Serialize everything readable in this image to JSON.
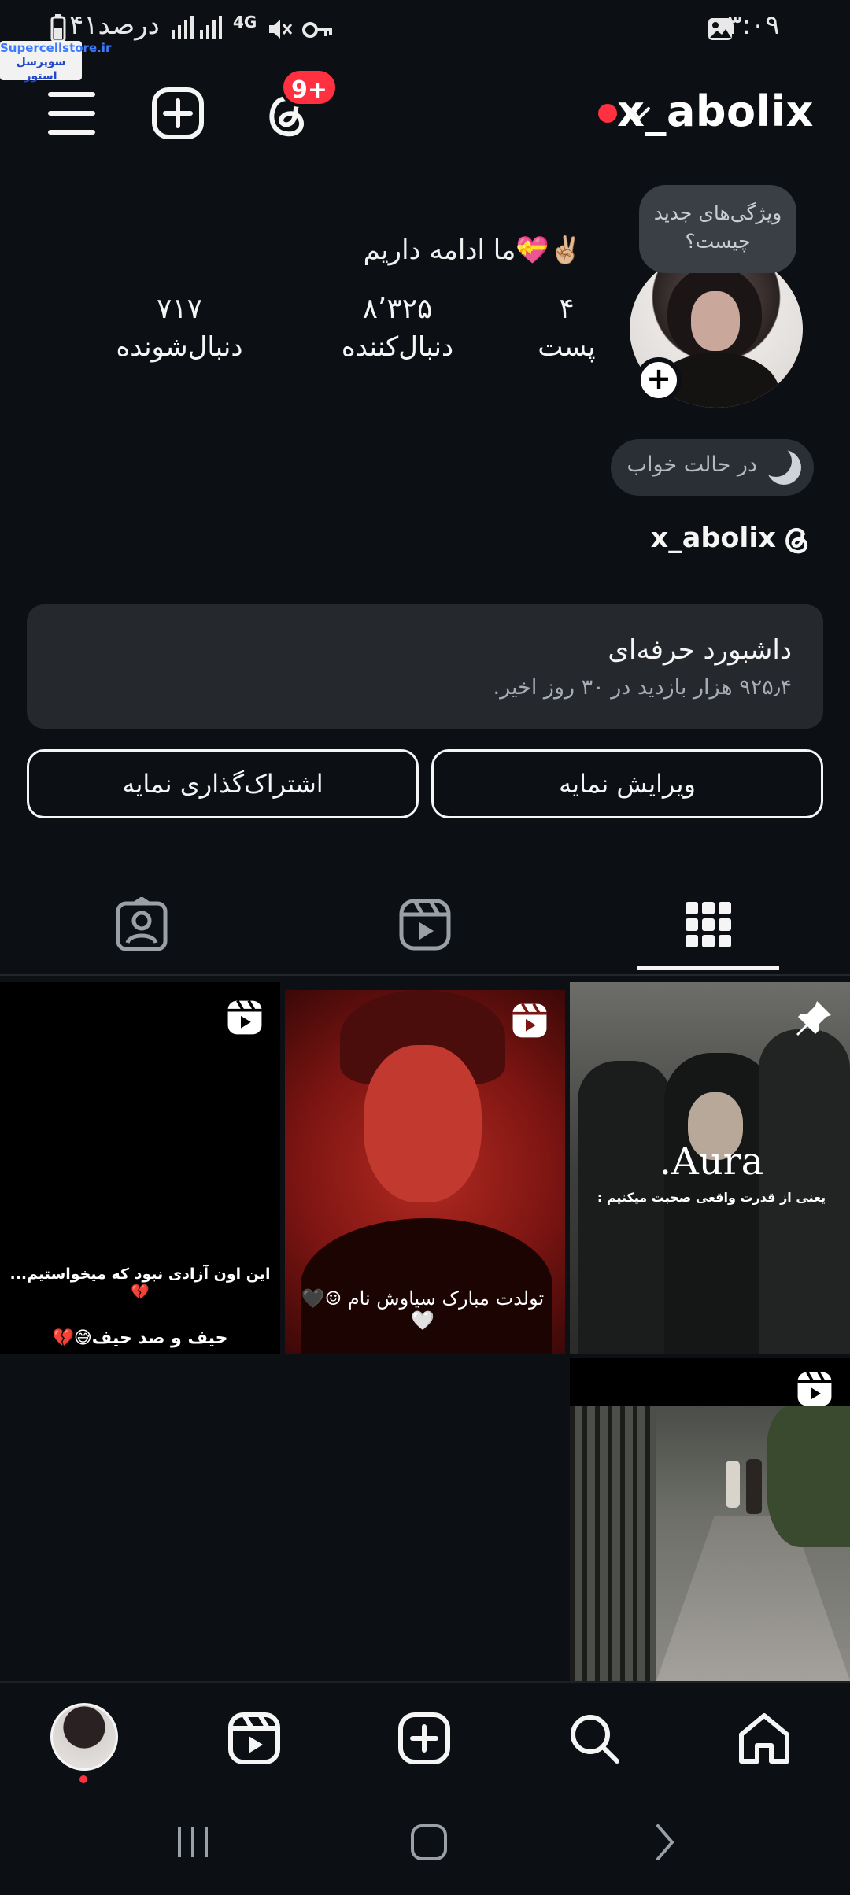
{
  "status_bar": {
    "time": "۰۳:۰۹",
    "battery": "۴۱درصد",
    "network": "4G",
    "watermark_line1": "Supercellstore.ir",
    "watermark_line2": "سوپرسل استور"
  },
  "header": {
    "username": "x_abolix",
    "notification_badge": "9+"
  },
  "profile": {
    "tooltip": "ویژگی‌های جدید چیست؟",
    "note": "✌🏼💝ما ادامه داریم",
    "stats": [
      {
        "value": "۴",
        "label": "پست"
      },
      {
        "value": "۸٬۳۲۵",
        "label": "دنبال‌کننده"
      },
      {
        "value": "۷۱۷",
        "label": "دنبال‌شونده"
      }
    ],
    "status_pill": "در حالت خواب",
    "threads_handle": "x_abolix"
  },
  "dashboard": {
    "title": "داشبورد حرفه‌ای",
    "subtitle": "۹۲۵٫۴ هزار بازدید در ۳۰ روز اخیر."
  },
  "buttons": {
    "edit_profile": "ویرایش نمایه",
    "share_profile": "اشتراک‌گذاری نمایه"
  },
  "posts": [
    {
      "caption_line1": "این اون آزادی نبود که میخواستیم... 💔",
      "caption_line2": "حیف و صد حیف😅💔"
    },
    {
      "caption": "تولدت مبارک سیاوش نام ☺🖤🤍"
    },
    {
      "caption_title": "Aura.",
      "caption_sub": "یعنی از قدرت واقعی صحبت میکنیم :"
    }
  ],
  "colors": {
    "background": "#0c1014",
    "accent_red": "#ff3040",
    "card": "#25292e",
    "text": "#f5f5f5"
  }
}
